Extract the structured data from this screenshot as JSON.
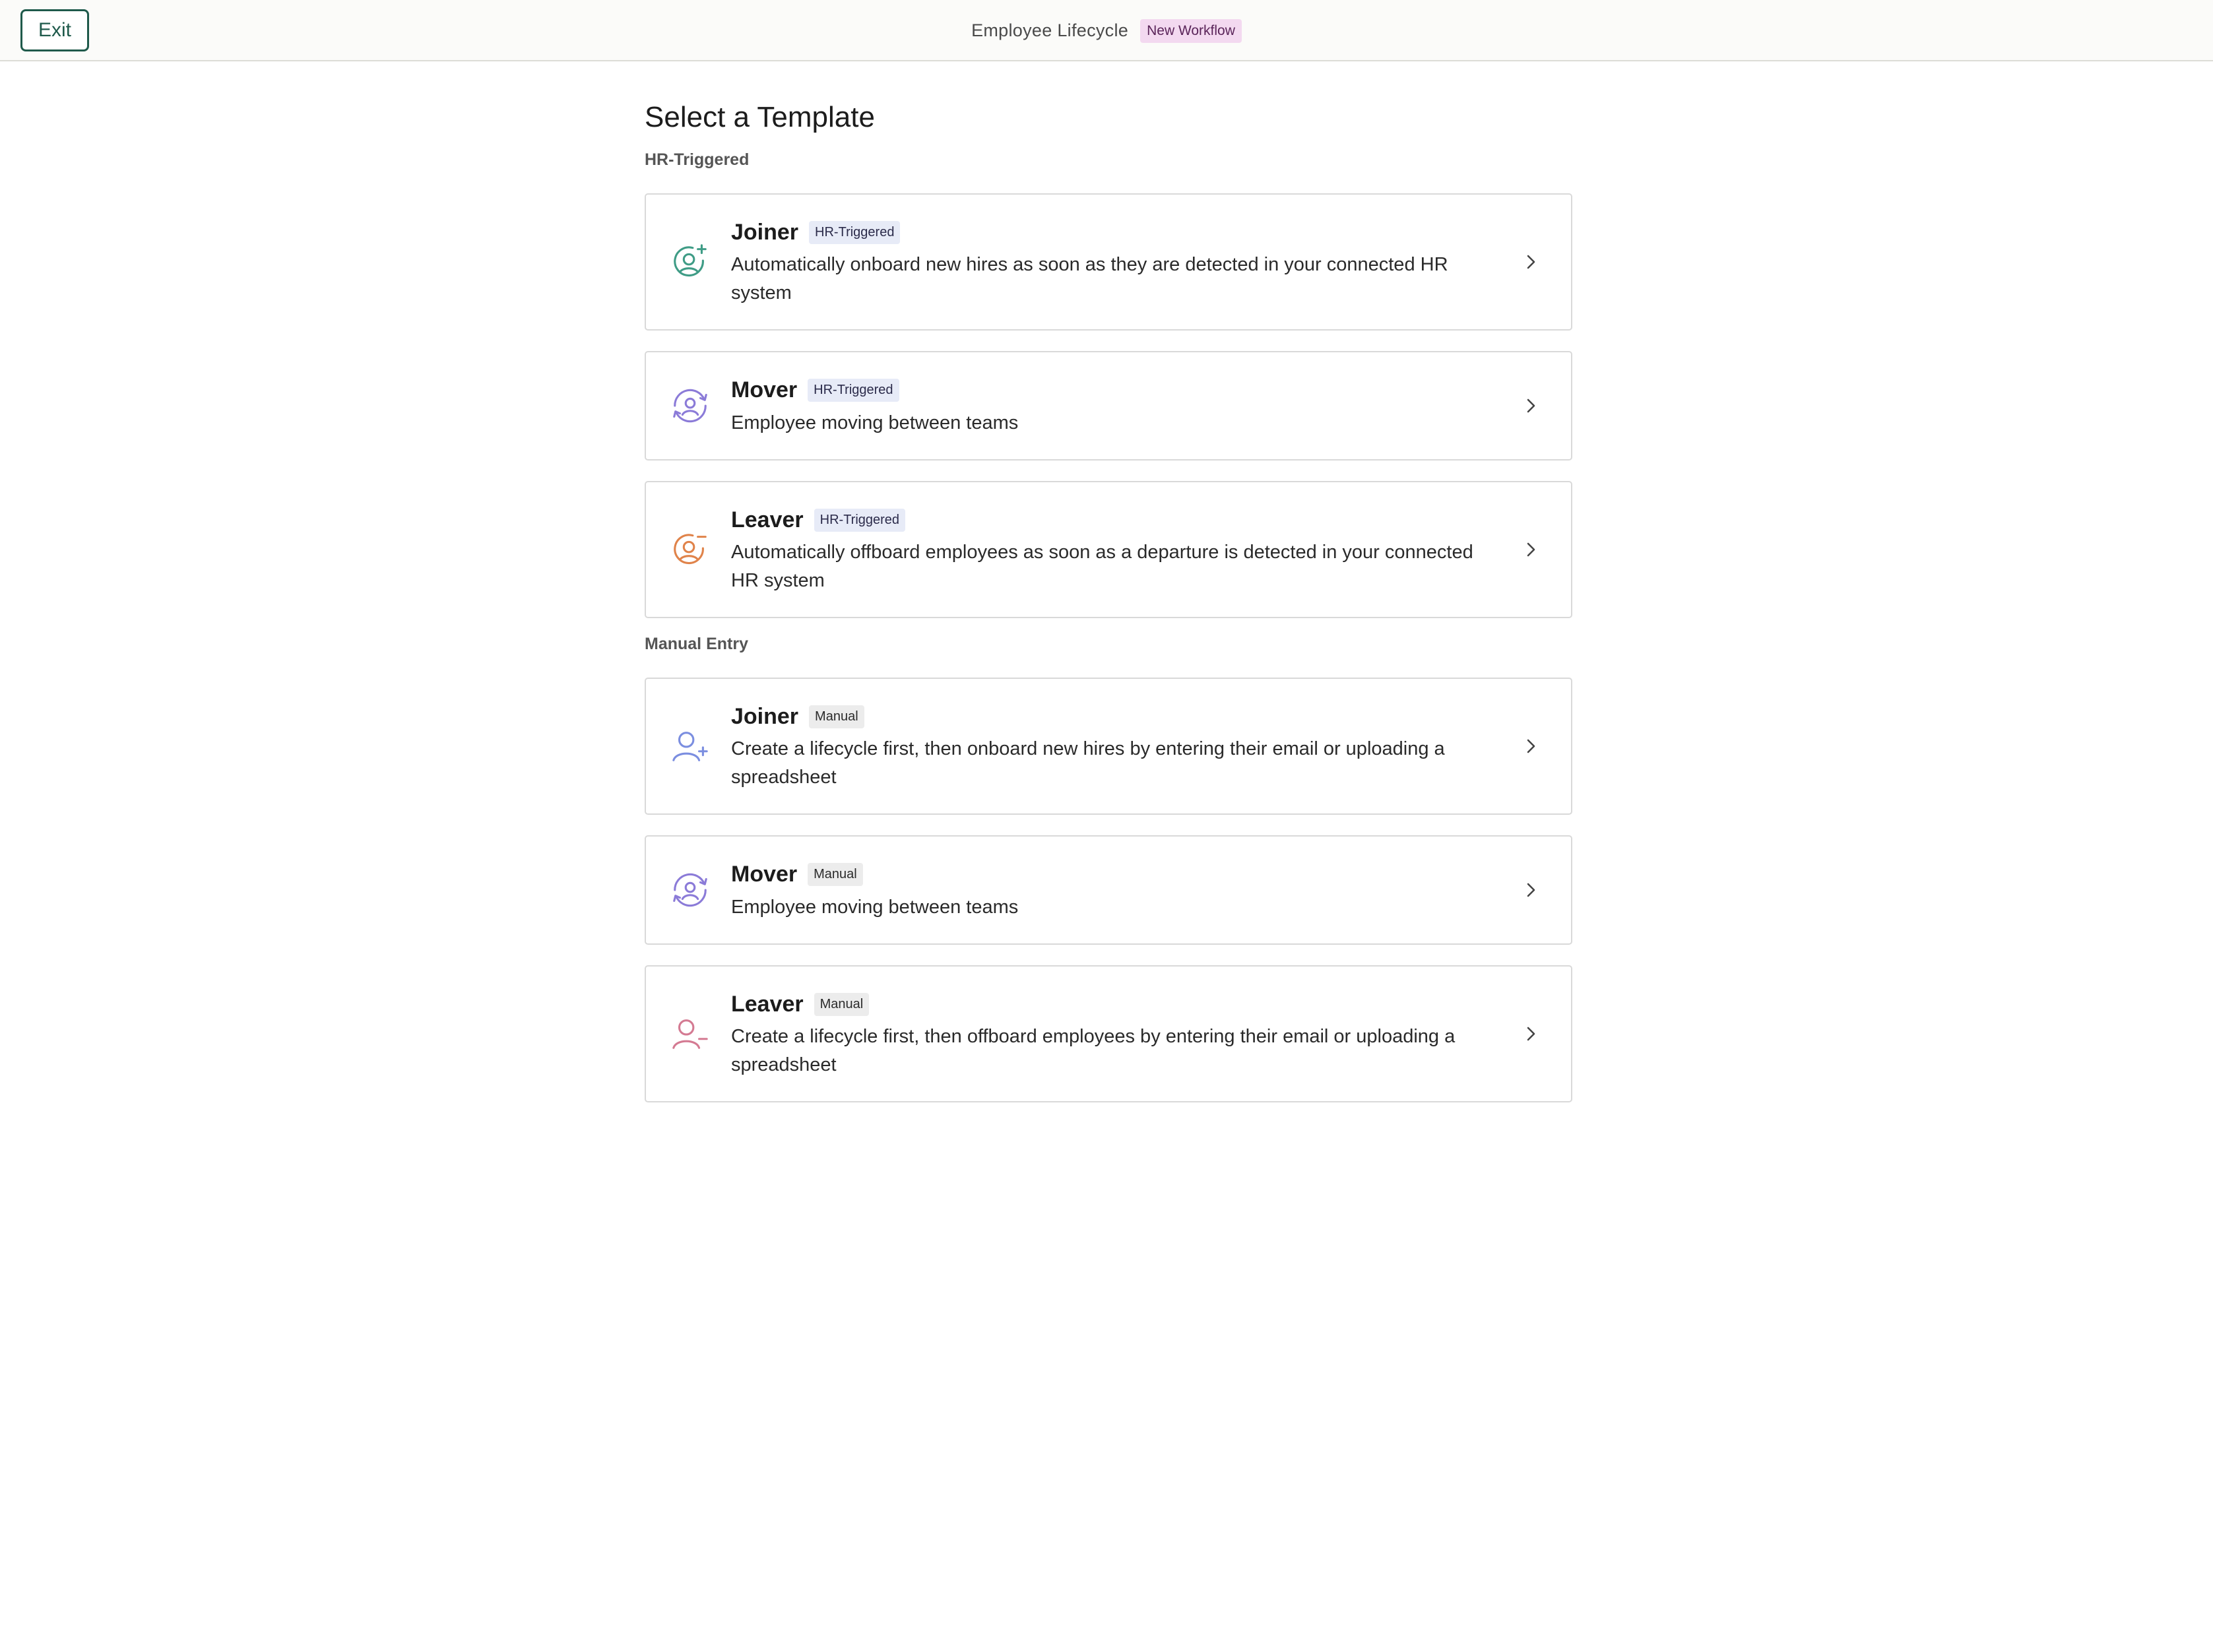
{
  "header": {
    "exit_label": "Exit",
    "app_title": "Employee Lifecycle",
    "workflow_badge": "New Workflow"
  },
  "page": {
    "title": "Select a Template"
  },
  "sections": [
    {
      "label": "HR-Triggered",
      "cards": [
        {
          "title": "Joiner",
          "tag": "HR-Triggered",
          "description": "Automatically onboard new hires as soon as they are detected in your connected HR system",
          "icon": "user-add-circle-icon",
          "icon_color": "#3f9c86"
        },
        {
          "title": "Mover",
          "tag": "HR-Triggered",
          "description": "Employee moving between teams",
          "icon": "user-move-icon",
          "icon_color": "#8b7bd8"
        },
        {
          "title": "Leaver",
          "tag": "HR-Triggered",
          "description": "Automatically offboard employees as soon as a departure is detected in your connected HR system",
          "icon": "user-remove-circle-icon",
          "icon_color": "#e0834a"
        }
      ]
    },
    {
      "label": "Manual Entry",
      "cards": [
        {
          "title": "Joiner",
          "tag": "Manual",
          "description": "Create a lifecycle first, then onboard new hires by entering their email or uploading a spreadsheet",
          "icon": "user-plus-icon",
          "icon_color": "#7b8ee0"
        },
        {
          "title": "Mover",
          "tag": "Manual",
          "description": "Employee moving between teams",
          "icon": "user-move-icon",
          "icon_color": "#8b7bd8"
        },
        {
          "title": "Leaver",
          "tag": "Manual",
          "description": "Create a lifecycle first, then offboard employees by entering their email or uploading a spreadsheet",
          "icon": "user-minus-icon",
          "icon_color": "#d47a92"
        }
      ]
    }
  ]
}
